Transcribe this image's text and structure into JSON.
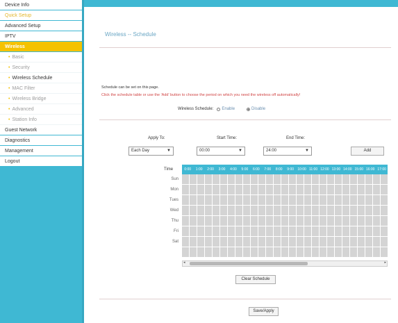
{
  "sidebar": {
    "items": [
      {
        "label": "Device Info",
        "type": "main"
      },
      {
        "label": "Quick Setup",
        "type": "highlight"
      },
      {
        "label": "Advanced Setup",
        "type": "main"
      },
      {
        "label": "IPTV",
        "type": "main"
      },
      {
        "label": "Wireless",
        "type": "active"
      },
      {
        "label": "Basic",
        "type": "sub"
      },
      {
        "label": "Security",
        "type": "sub"
      },
      {
        "label": "Wireless Schedule",
        "type": "sub-current"
      },
      {
        "label": "MAC Filter",
        "type": "sub"
      },
      {
        "label": "Wireless Bridge",
        "type": "sub"
      },
      {
        "label": "Advanced",
        "type": "sub"
      },
      {
        "label": "Station Info",
        "type": "sub"
      },
      {
        "label": "Guest Network",
        "type": "main"
      },
      {
        "label": "Diagnostics",
        "type": "main"
      },
      {
        "label": "Management",
        "type": "main"
      },
      {
        "label": "Logout",
        "type": "main"
      }
    ]
  },
  "page": {
    "title": "Wireless -- Schedule",
    "note_line1": "Schedule can be set on this page.",
    "note_line2": "Click the schedule table or use the 'Add' button to choose the period on which you need the wireless off automatically!",
    "wireless_schedule_label": "Wireless Schedule:",
    "enable_label": "Enable",
    "disable_label": "Disable",
    "selected_option": "Disable"
  },
  "controls": {
    "apply_to_label": "Apply To:",
    "apply_to_value": "Each Day",
    "start_time_label": "Start Time:",
    "start_time_value": "00:00",
    "end_time_label": "End Time:",
    "end_time_value": "24:00",
    "add_button": "Add"
  },
  "schedule": {
    "time_label": "Time",
    "hours": [
      "0:00",
      "1:00",
      "2:00",
      "3:00",
      "4:00",
      "5:00",
      "6:00",
      "7:00",
      "8:00",
      "9:00",
      "10:00",
      "11:00",
      "12:00",
      "13:00",
      "14:00",
      "15:00",
      "16:00",
      "17:00"
    ],
    "days": [
      "Sun",
      "Mon",
      "Tues",
      "Wed",
      "Thu",
      "Fri",
      "Sat"
    ]
  },
  "buttons": {
    "clear_schedule": "Clear Schedule",
    "save_apply": "Save/Apply"
  },
  "colors": {
    "accent": "#3fb8d3",
    "active_nav": "#f4c200",
    "warning_text": "#d04545"
  }
}
